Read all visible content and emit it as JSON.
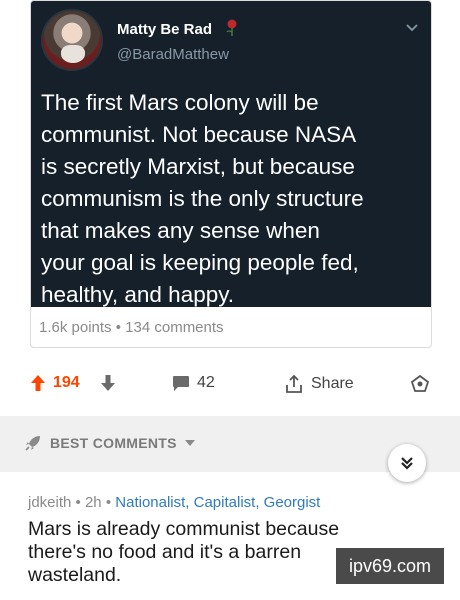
{
  "tweet": {
    "author_name": "Matty Be Rad",
    "handle": "@BaradMatthew",
    "text": "The first Mars colony will be\ncommunist. Not because NASA\nis secretly Marxist, but because\ncommunism is the only structure\nthat makes any sense when\nyour goal is keeping people fed,\nhealthy, and happy."
  },
  "post": {
    "points": "1.6k points",
    "separator": "•",
    "comments": "134 comments"
  },
  "actions": {
    "upvote_count": "194",
    "comment_count": "42",
    "share_label": "Share"
  },
  "sort": {
    "label": "BEST COMMENTS"
  },
  "comment": {
    "username": "jdkeith",
    "separator1": "•",
    "time": "2h",
    "separator2": "•",
    "flair": "Nationalist, Capitalist, Georgist",
    "body": "Mars is already communist because\nthere's no food and it's a barren\nwasteland."
  },
  "watermark": {
    "text": "ipv69.com"
  },
  "colors": {
    "tweet_bg": "#15202b",
    "upvote": "#ff4500",
    "flair": "#2f7bbf"
  }
}
